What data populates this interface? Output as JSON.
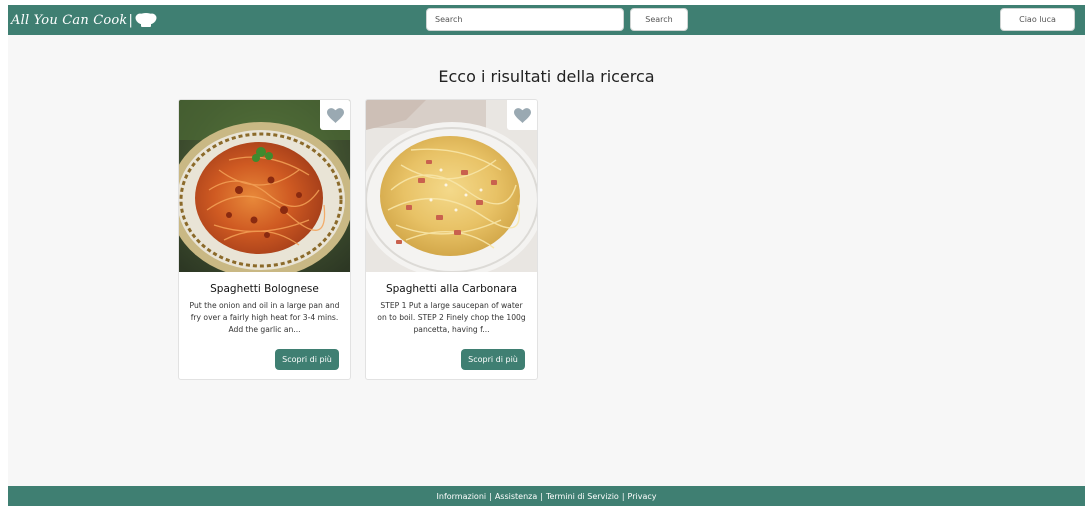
{
  "navbar": {
    "brand_text": "All You Can Cook",
    "brand_separator": "|",
    "brand_icon": "chef-hat-icon",
    "search_placeholder": "Search",
    "search_button": "Search",
    "user_button": "Ciao luca"
  },
  "main": {
    "title": "Ecco i risultati della ricerca",
    "cards": [
      {
        "title": "Spaghetti Bolognese",
        "description": "Put the onion and oil in a large pan and fry over a fairly high heat for 3-4 mins. Add the garlic an...",
        "button": "Scopri di più",
        "image": "spaghetti-bolognese-photo",
        "favorite_icon": "heart-icon"
      },
      {
        "title": "Spaghetti alla Carbonara",
        "description": "STEP 1 Put a large saucepan of water on to boil. STEP 2 Finely chop the 100g pancetta, having f...",
        "button": "Scopri di più",
        "image": "spaghetti-carbonara-photo",
        "favorite_icon": "heart-icon"
      }
    ]
  },
  "footer": {
    "links": [
      "Informazioni",
      "Assistenza",
      "Termini di Servizio",
      "Privacy"
    ],
    "separator": "|"
  },
  "colors": {
    "primary": "#3f7f72",
    "page_background": "#f7f7f7",
    "heart": "#9aa9b2"
  }
}
